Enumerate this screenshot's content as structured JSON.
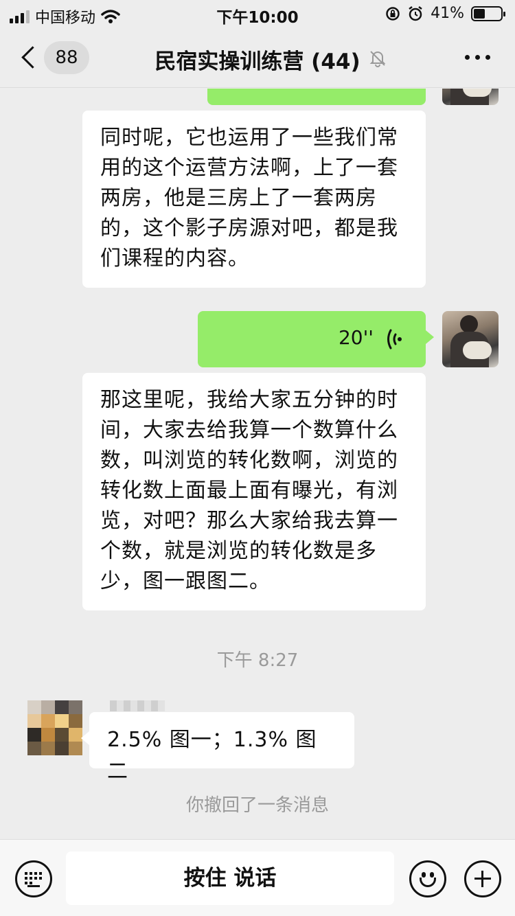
{
  "status_bar": {
    "carrier": "中国移动",
    "time": "下午10:00",
    "battery_percent": "41%",
    "battery_level": 0.41
  },
  "header": {
    "unread_count": "88",
    "title": "民宿实操训练营 (44)",
    "icons": [
      "back-arrow-icon",
      "mute-bell-icon",
      "more-options-icon"
    ]
  },
  "messages": [
    {
      "type": "text",
      "side": "left",
      "text": "同时呢，它也运用了一些我们常用的这个运营方法啊，上了一套两房，他是三房上了一套两房的，这个影子房源对吧，都是我们课程的内容。"
    },
    {
      "type": "voice",
      "side": "right",
      "duration": "20''"
    },
    {
      "type": "text",
      "side": "left",
      "text": "那这里呢，我给大家五分钟的时间，大家去给我算一个数算什么数，叫浏览的转化数啊，浏览的转化数上面最上面有曝光，有浏览，对吧？那么大家给我去算一个数，就是浏览的转化数是多少，图一跟图二。"
    },
    {
      "type": "timestamp",
      "text": "下午 8:27"
    },
    {
      "type": "text",
      "side": "left",
      "text": "2.5% 图一；1.3% 图二"
    },
    {
      "type": "system",
      "text": "你撤回了一条消息"
    }
  ],
  "input_bar": {
    "hold_to_talk_label": "按住 说话",
    "icons": [
      "keyboard-icon",
      "emoji-icon",
      "plus-icon"
    ]
  },
  "colors": {
    "background": "#ededed",
    "self_bubble": "#95ec69",
    "other_bubble": "#ffffff",
    "meta_text": "#9a9a9a"
  }
}
